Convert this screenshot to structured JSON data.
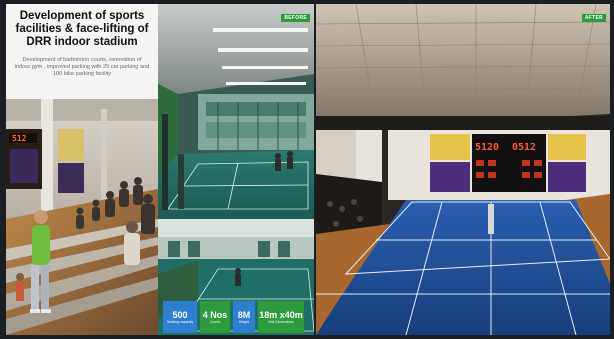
{
  "title": "Development of sports facilities & face-lifting of DRR indoor stadium",
  "description": "Development of badminton courts, renovation of indoor gym , improved parking with 25 car parking and 100 bike parking facility",
  "tags": {
    "before": "BEFORE",
    "after": "AFTER"
  },
  "stats": [
    {
      "value": "500",
      "label": "Seating capacity",
      "color": "#2f7fd0"
    },
    {
      "value": "4 Nos",
      "label": "Courts",
      "color": "#2e9b3c"
    },
    {
      "value": "8M",
      "label": "Height",
      "color": "#2f7fd0"
    },
    {
      "value": "18m x40m",
      "label": "Hall Dimensions",
      "color": "#2e9b3c"
    }
  ],
  "scoreboards": {
    "left": "512",
    "right_a": "5120",
    "right_b": "0512"
  },
  "colors": {
    "court_blue": "#1f5aa8",
    "court_green": "#1f6b62",
    "wood_floor": "#b06a2e"
  }
}
